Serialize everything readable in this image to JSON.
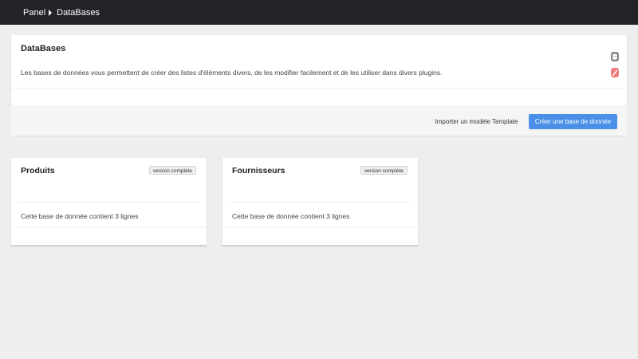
{
  "breadcrumb": {
    "items": [
      "Panel",
      "DataBases"
    ]
  },
  "header": {
    "title": "DataBases",
    "description": "Les bases de données vous permettent de créer des listes d'éléments divers, de les modifier facilement et de les utiliser dans divers plugins.",
    "icons": [
      "database-icon",
      "edit-icon"
    ]
  },
  "actions": {
    "import_label": "Importer un modèle Template",
    "create_label": "Créer une base de donnée"
  },
  "databases": [
    {
      "name": "Produits",
      "badge": "version complète",
      "info": "Cette base de donnée contient 3 lignes"
    },
    {
      "name": "Fournisseurs",
      "badge": "version complète",
      "info": "Cette base de donnée contient 3 lignes"
    }
  ],
  "colors": {
    "topbar": "#212326",
    "accent": "#4a90e8",
    "edit_icon": "#f27c7c",
    "db_icon": "#888888"
  }
}
